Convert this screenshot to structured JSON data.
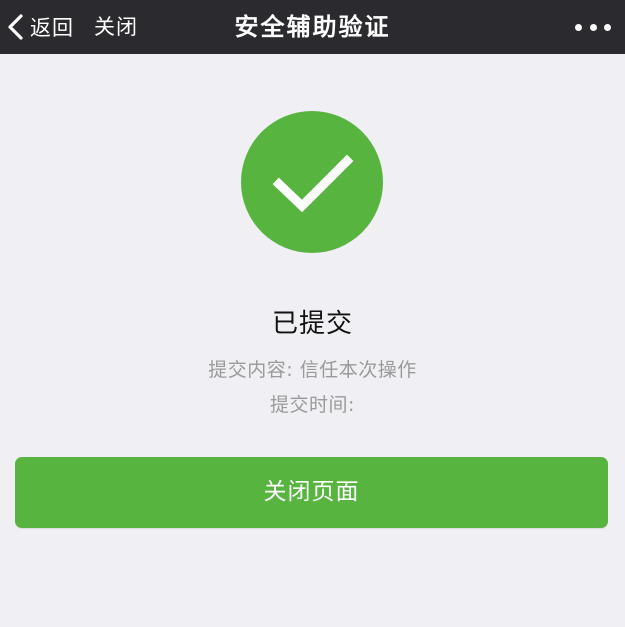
{
  "navbar": {
    "back_label": "返回",
    "close_label": "关闭",
    "title": "安全辅助验证",
    "more_icon": "more-dots-icon",
    "back_icon": "chevron-left-icon"
  },
  "status": {
    "icon": "checkmark-icon",
    "title": "已提交",
    "content_line": "提交内容: 信任本次操作",
    "time_line": "提交时间:"
  },
  "actions": {
    "close_page_label": "关闭页面"
  },
  "colors": {
    "navbar_bg": "#2b2b2f",
    "page_bg": "#efeff4",
    "accent_green": "#57b43f",
    "muted_text": "#9a9a9a"
  }
}
